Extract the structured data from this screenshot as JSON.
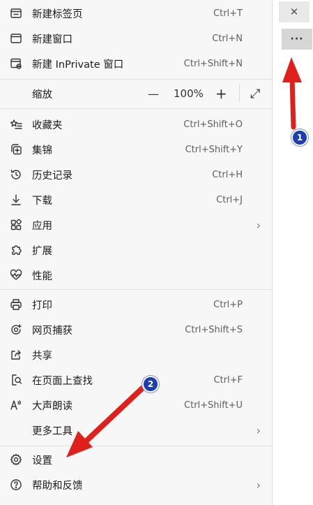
{
  "browser": {
    "close_glyph": "✕",
    "more_glyph": "···"
  },
  "menu": {
    "new_tab": {
      "label": "新建标签页",
      "shortcut": "Ctrl+T"
    },
    "new_window": {
      "label": "新建窗口",
      "shortcut": "Ctrl+N"
    },
    "new_inprivate": {
      "label": "新建 InPrivate 窗口",
      "shortcut": "Ctrl+Shift+N"
    },
    "zoom": {
      "label": "缩放",
      "value": "100%",
      "minus": "—",
      "plus": "+",
      "fullscreen": "⤢"
    },
    "favorites": {
      "label": "收藏夹",
      "shortcut": "Ctrl+Shift+O"
    },
    "collections": {
      "label": "集锦",
      "shortcut": "Ctrl+Shift+Y"
    },
    "history": {
      "label": "历史记录",
      "shortcut": "Ctrl+H"
    },
    "downloads": {
      "label": "下载",
      "shortcut": "Ctrl+J"
    },
    "apps": {
      "label": "应用",
      "chevron": "›"
    },
    "extensions": {
      "label": "扩展"
    },
    "performance": {
      "label": "性能"
    },
    "print": {
      "label": "打印",
      "shortcut": "Ctrl+P"
    },
    "web_capture": {
      "label": "网页捕获",
      "shortcut": "Ctrl+Shift+S"
    },
    "share": {
      "label": "共享"
    },
    "find_on_page": {
      "label": "在页面上查找",
      "shortcut": "Ctrl+F"
    },
    "read_aloud": {
      "label": "大声朗读",
      "shortcut": "Ctrl+Shift+U"
    },
    "more_tools": {
      "label": "更多工具",
      "chevron": "›"
    },
    "settings": {
      "label": "设置"
    },
    "help_feedback": {
      "label": "帮助和反馈",
      "chevron": "›"
    }
  },
  "annotations": {
    "badge_1": "1",
    "badge_2": "2",
    "arrow_color": "#e0201b",
    "badge_color": "#1a3fb0"
  }
}
